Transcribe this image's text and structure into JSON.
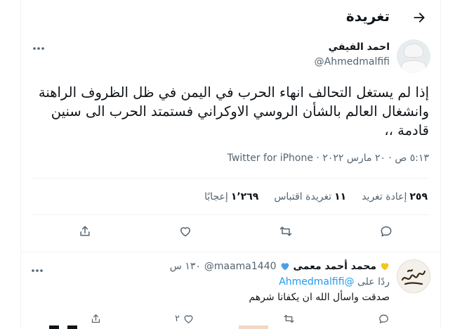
{
  "header": {
    "title": "تغريدة"
  },
  "tweet": {
    "author_name": "احمد الفيفي",
    "author_handle": "@Ahmedmalfifi",
    "text": "إذا لم يستغل التحالف انهاء الحرب في اليمن في ظل الظروف الراهنة وانشغال العالم بالشأن الروسي الاوكراني فستمتد الحرب الى سنين قادمة ،،",
    "meta": "٥:١٣ ص · ٢٠ مارس ٢٠٢٢ · Twitter for iPhone",
    "stats": {
      "retweets_count": "٢٥٩",
      "retweets_label": "إعادة تغريد",
      "quotes_count": "١١",
      "quotes_label": "تغريدة اقتباس",
      "likes_count": "١٬٢٦٩",
      "likes_label": "إعجابًا"
    }
  },
  "reply": {
    "author_name": "محمد أحمد معمى",
    "author_handle": "@maama1440",
    "time": "١٣٠ س",
    "replying_prefix": "ردًا على",
    "replying_to": "@Ahmedmalfifi",
    "text": "صدقت واسأل الله ان يكفانا شرهم",
    "likes_count": "٢"
  },
  "icons": {
    "back": "arrow-right-icon",
    "more": "more-horizontal-icon",
    "reply": "comment-icon",
    "retweet": "retweet-icon",
    "like": "heart-icon",
    "share": "share-icon",
    "verified": "blue-heart-emoji",
    "yellow_heart": "yellow-heart-emoji"
  },
  "colors": {
    "link": "#1d9bf0",
    "muted": "#536471",
    "text": "#0f1419"
  }
}
